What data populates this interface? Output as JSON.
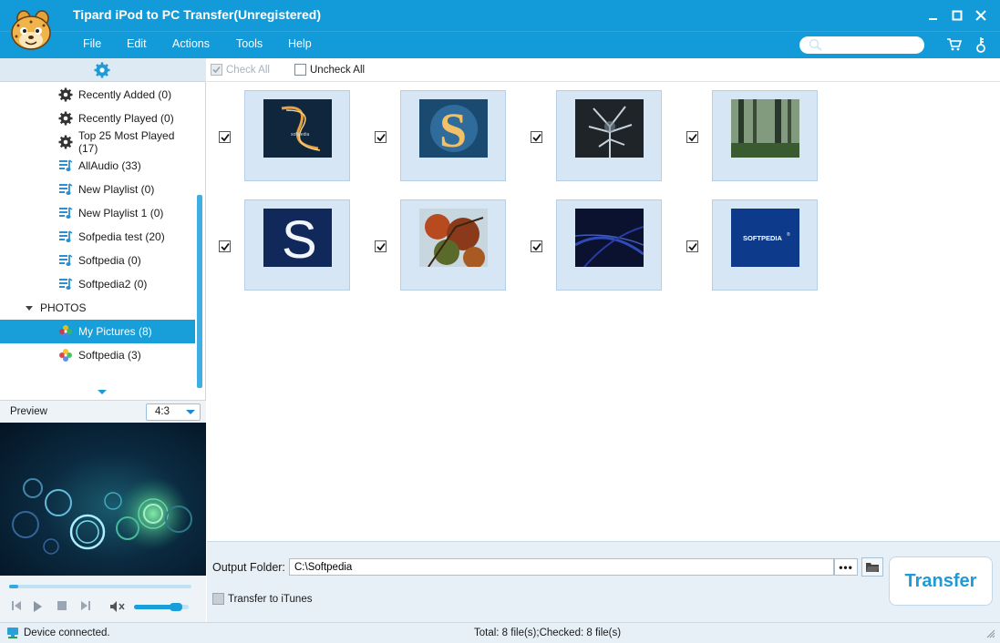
{
  "window": {
    "title": "Tipard iPod to PC Transfer(Unregistered)"
  },
  "menu": {
    "file": "File",
    "edit": "Edit",
    "actions": "Actions",
    "tools": "Tools",
    "help": "Help"
  },
  "search": {
    "placeholder": ""
  },
  "library": {
    "items": [
      {
        "label": "Recently Added (0)",
        "icon": "gear-icon"
      },
      {
        "label": "Recently Played (0)",
        "icon": "gear-icon"
      },
      {
        "label": "Top 25 Most Played (17)",
        "icon": "gear-icon"
      },
      {
        "label": "AllAudio (33)",
        "icon": "playlist-icon"
      },
      {
        "label": "New Playlist (0)",
        "icon": "playlist-icon"
      },
      {
        "label": "New Playlist 1 (0)",
        "icon": "playlist-icon"
      },
      {
        "label": "Sofpedia test (20)",
        "icon": "playlist-icon"
      },
      {
        "label": "Softpedia (0)",
        "icon": "playlist-icon"
      },
      {
        "label": "Softpedia2 (0)",
        "icon": "playlist-icon"
      }
    ],
    "photos_header": "PHOTOS",
    "photo_albums": [
      {
        "label": "My Pictures (8)",
        "icon": "photos-icon",
        "selected": true
      },
      {
        "label": "Softpedia (3)",
        "icon": "photos-icon",
        "selected": false
      }
    ]
  },
  "preview": {
    "label": "Preview",
    "ratio": "4:3"
  },
  "player": {
    "seek_fraction": 0.05,
    "volume_fraction": 0.85
  },
  "toolbar": {
    "check_all": "Check All",
    "uncheck_all": "Uncheck All"
  },
  "thumbnails": [
    {
      "checked": true,
      "subject": "blue swirl S logo"
    },
    {
      "checked": true,
      "subject": "glowing S logo"
    },
    {
      "checked": true,
      "subject": "dark crystal plant"
    },
    {
      "checked": true,
      "subject": "misty forest"
    },
    {
      "checked": true,
      "subject": "white S on navy"
    },
    {
      "checked": true,
      "subject": "autumn leaves"
    },
    {
      "checked": true,
      "subject": "dark blue rays"
    },
    {
      "checked": true,
      "subject": "SOFTPEDIA logo",
      "text": "SOFTPEDIA",
      "mark": "®"
    }
  ],
  "output": {
    "label": "Output Folder:",
    "path": "C:\\Softpedia",
    "browse": "•••",
    "itunes_label": "Transfer to iTunes",
    "transfer_label": "Transfer"
  },
  "status": {
    "device": "Device connected.",
    "counts": "Total: 8 file(s);Checked: 8 file(s)"
  },
  "colors": {
    "accent": "#139ad9",
    "selected": "#189ed9",
    "transfer_text": "#1e9ad6"
  }
}
